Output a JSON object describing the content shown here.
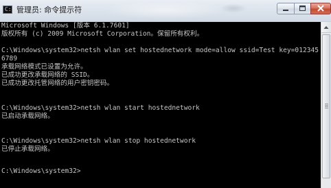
{
  "window": {
    "title": "管理员: 命令提示符",
    "icon": "cmd-icon"
  },
  "title_controls": {
    "minimize_icon": "minimize-icon",
    "maximize_icon": "maximize-icon",
    "close_icon": "close-icon"
  },
  "console": {
    "lines": [
      "Microsoft Windows [版本 6.1.7601]",
      "版权所有 (c) 2009 Microsoft Corporation。保留所有权利。",
      "",
      "C:\\Windows\\system32>netsh wlan set hostednetwork mode=allow ssid=Test key=012345",
      "6789",
      "承载网络模式已设置为允许。",
      "已成功更改承载网络的 SSID。",
      "已成功更改托管网络的用户密钥密码。",
      "",
      "",
      "C:\\Windows\\system32>netsh wlan start hostednetwork",
      "已启动承载网络。",
      "",
      "",
      "C:\\Windows\\system32>netsh wlan stop hostednetwork",
      "已停止承载网络。",
      "",
      "",
      "C:\\Windows\\system32>"
    ]
  },
  "colors": {
    "console_bg": "#000000",
    "console_text": "#c6c6c6",
    "titlebar": "#dde4ec",
    "close_button": "#c44a34"
  }
}
